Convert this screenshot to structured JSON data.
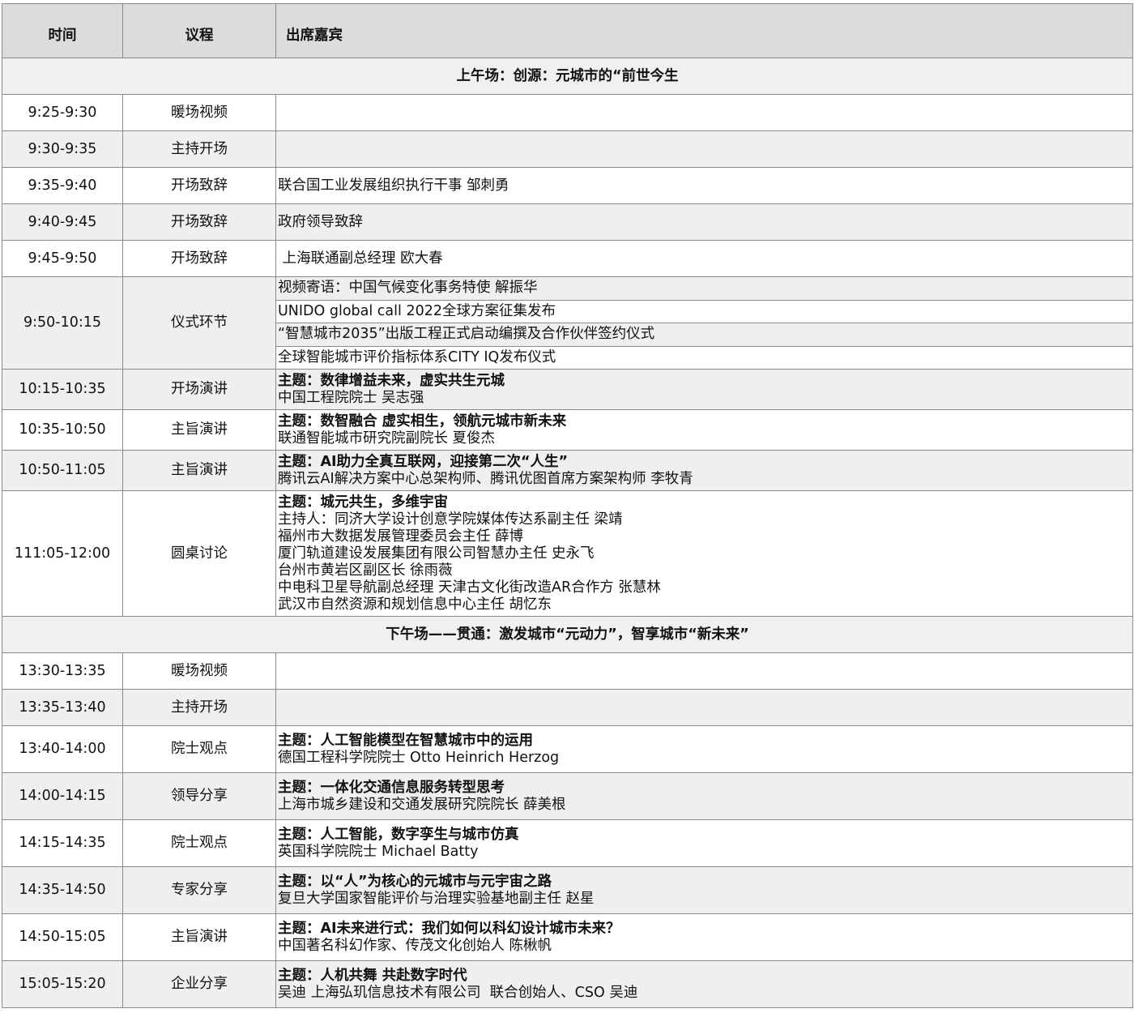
{
  "headers": {
    "time": "时间",
    "item": "议程",
    "guests": "出席嘉宾"
  },
  "morning": {
    "section_title": "上午场：创源：元城市的“前世今生",
    "rows": [
      {
        "time": "9:25-9:30",
        "item": "暖场视频"
      },
      {
        "time": "9:30-9:35",
        "item": "主持开场"
      },
      {
        "time": "9:35-9:40",
        "item": "开场致辞",
        "guest": "联合国工业发展组织执行干事 邹刺勇"
      },
      {
        "time": "9:40-9:45",
        "item": "开场致辞",
        "guest": "政府领导致辞"
      },
      {
        "time": "9:45-9:50",
        "item": "开场致辞",
        "guest": " 上海联通副总经理 欧大春"
      },
      {
        "time": "9:50-10:15",
        "item": "仪式环节",
        "subs": [
          "视频寄语：中国气候变化事务特使 解振华",
          "UNIDO global call 2022全球方案征集发布",
          "“智慧城市2035”出版工程正式启动编撰及合作伙伴签约仪式",
          "全球智能城市评价指标体系CITY IQ发布仪式"
        ]
      },
      {
        "time": "10:15-10:35",
        "item": "开场演讲",
        "topic": "主题：数律增益未来，虚实共生元城",
        "lines": [
          "中国工程院院士 吴志强"
        ]
      },
      {
        "time": "10:35-10:50",
        "item": "主旨演讲",
        "topic": "主题：数智融合 虚实相生，领航元城市新未来",
        "lines": [
          "联通智能城市研究院副院长 夏俊杰"
        ]
      },
      {
        "time": "10:50-11:05",
        "item": "主旨演讲",
        "topic": "主题：AI助力全真互联网，迎接第二次“人生”",
        "lines": [
          "腾讯云AI解决方案中心总架构师、腾讯优图首席方案架构师 李牧青"
        ]
      },
      {
        "time": "111:05-12:00",
        "item": "圆桌讨论",
        "topic": "主题：城元共生，多维宇宙",
        "lines": [
          "主持人：同济大学设计创意学院媒体传达系副主任 梁靖",
          "福州市大数据发展管理委员会主任 薛博",
          "厦门轨道建设发展集团有限公司智慧办主任 史永飞",
          "台州市黄岩区副区长 徐雨薇",
          "中电科卫星导航副总经理 天津古文化街改造AR合作方 张慧林",
          "武汉市自然资源和规划信息中心主任 胡忆东"
        ]
      }
    ]
  },
  "afternoon": {
    "section_title": "下午场——贯通：激发城市“元动力”，智享城市“新未来”",
    "rows": [
      {
        "time": "13:30-13:35",
        "item": "暖场视频"
      },
      {
        "time": "13:35-13:40",
        "item": "主持开场"
      },
      {
        "time": "13:40-14:00",
        "item": "院士观点",
        "topic": "主题：人工智能模型在智慧城市中的运用",
        "lines": [
          "德国工程科学院院士 Otto Heinrich Herzog"
        ]
      },
      {
        "time": "14:00-14:15",
        "item": "领导分享",
        "topic": "主题：一体化交通信息服务转型思考",
        "lines": [
          "上海市城乡建设和交通发展研究院院长 薛美根"
        ]
      },
      {
        "time": "14:15-14:35",
        "item": "院士观点",
        "topic": "主题：人工智能，数字孪生与城市仿真",
        "lines": [
          "英国科学院院士 Michael Batty"
        ]
      },
      {
        "time": "14:35-14:50",
        "item": "专家分享",
        "topic": "主题：以“人”为核心的元城市与元宇宙之路",
        "lines": [
          "复旦大学国家智能评价与治理实验基地副主任 赵星"
        ]
      },
      {
        "time": "14:50-15:05",
        "item": "主旨演讲",
        "topic": "主题：AI未来进行式：我们如何以科幻设计城市未来？",
        "lines": [
          "中国著名科幻作家、传茂文化创始人 陈楸帆"
        ]
      },
      {
        "time": "15:05-15:20",
        "item": "企业分享",
        "topic": "主题：人机共舞 共赴数字时代",
        "lines": [
          "吴迪 上海弘玑信息技术有限公司  联合创始人、CSO 吴迪"
        ]
      }
    ]
  }
}
